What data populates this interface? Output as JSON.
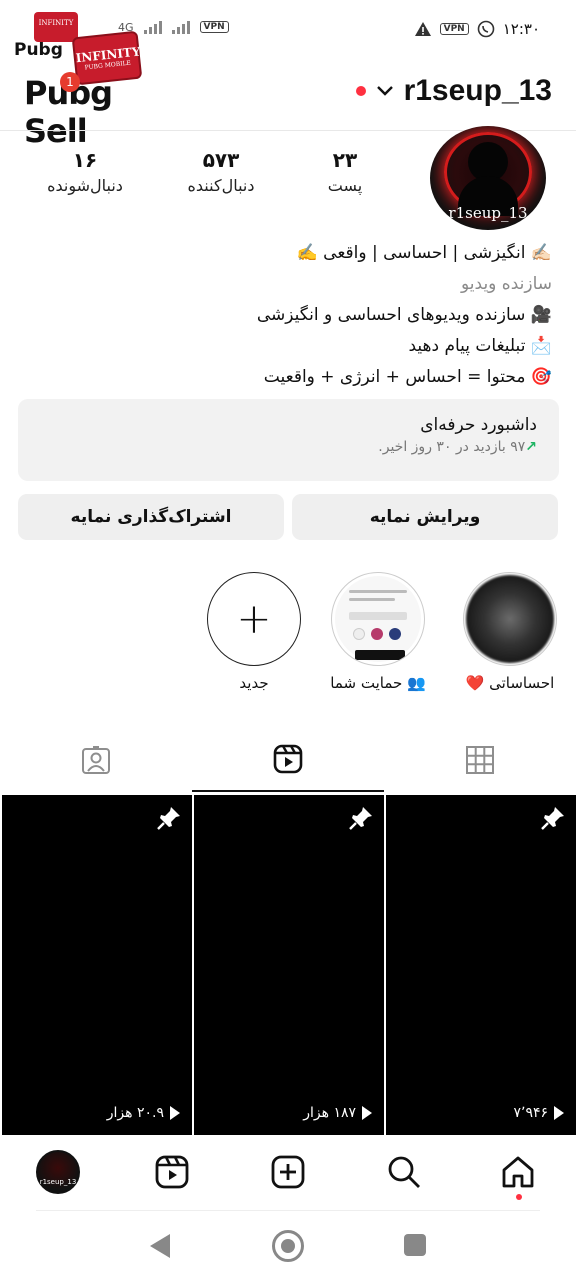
{
  "status_bar": {
    "time": "۱۲:۳۰",
    "network": "4G",
    "vpn_label": "VPN"
  },
  "overlay_logo": {
    "brand_small": "INFINITY",
    "brand_sub": "PUBG MOBILE",
    "brand_main": "INFINITY",
    "text_top": "Pubg",
    "text_main": "Pubg Sell",
    "notification_count": "1"
  },
  "header": {
    "username": "r1seup_13"
  },
  "profile": {
    "avatar_name": "r1seup_13",
    "stats": {
      "posts": {
        "value": "۲۳",
        "label": "پست"
      },
      "followers": {
        "value": "۵۷۳",
        "label": "دنبال‌کننده"
      },
      "following": {
        "value": "۱۶",
        "label": "دنبال‌شونده"
      }
    },
    "bio": {
      "line1": "✍🏻 انگیزشی | احساسی | واقعی ✍️",
      "category": "سازنده ویدیو",
      "line2": "🎥 سازنده ویدیوهای احساسی و انگیزشی",
      "line3": "📩 تبلیغات پیام دهید",
      "line4": "🎯 محتوا = احساس + انرژی + واقعیت"
    }
  },
  "dashboard": {
    "title": "داشبورد حرفه‌ای",
    "arrow": "↗",
    "subtitle": "۹۷ بازدید در ۳۰ روز اخیر."
  },
  "buttons": {
    "edit": "ویرایش نمایه",
    "share": "اشتراک‌گذاری نمایه"
  },
  "highlights": [
    {
      "label": "احساساتی ❤️"
    },
    {
      "label": "👥 حمایت شما"
    },
    {
      "label": "جدید"
    }
  ],
  "grid": [
    {
      "views": "۷٬۹۴۶"
    },
    {
      "views": "۱۸۷ هزار"
    },
    {
      "views": "۲۰.۹ هزار"
    }
  ]
}
